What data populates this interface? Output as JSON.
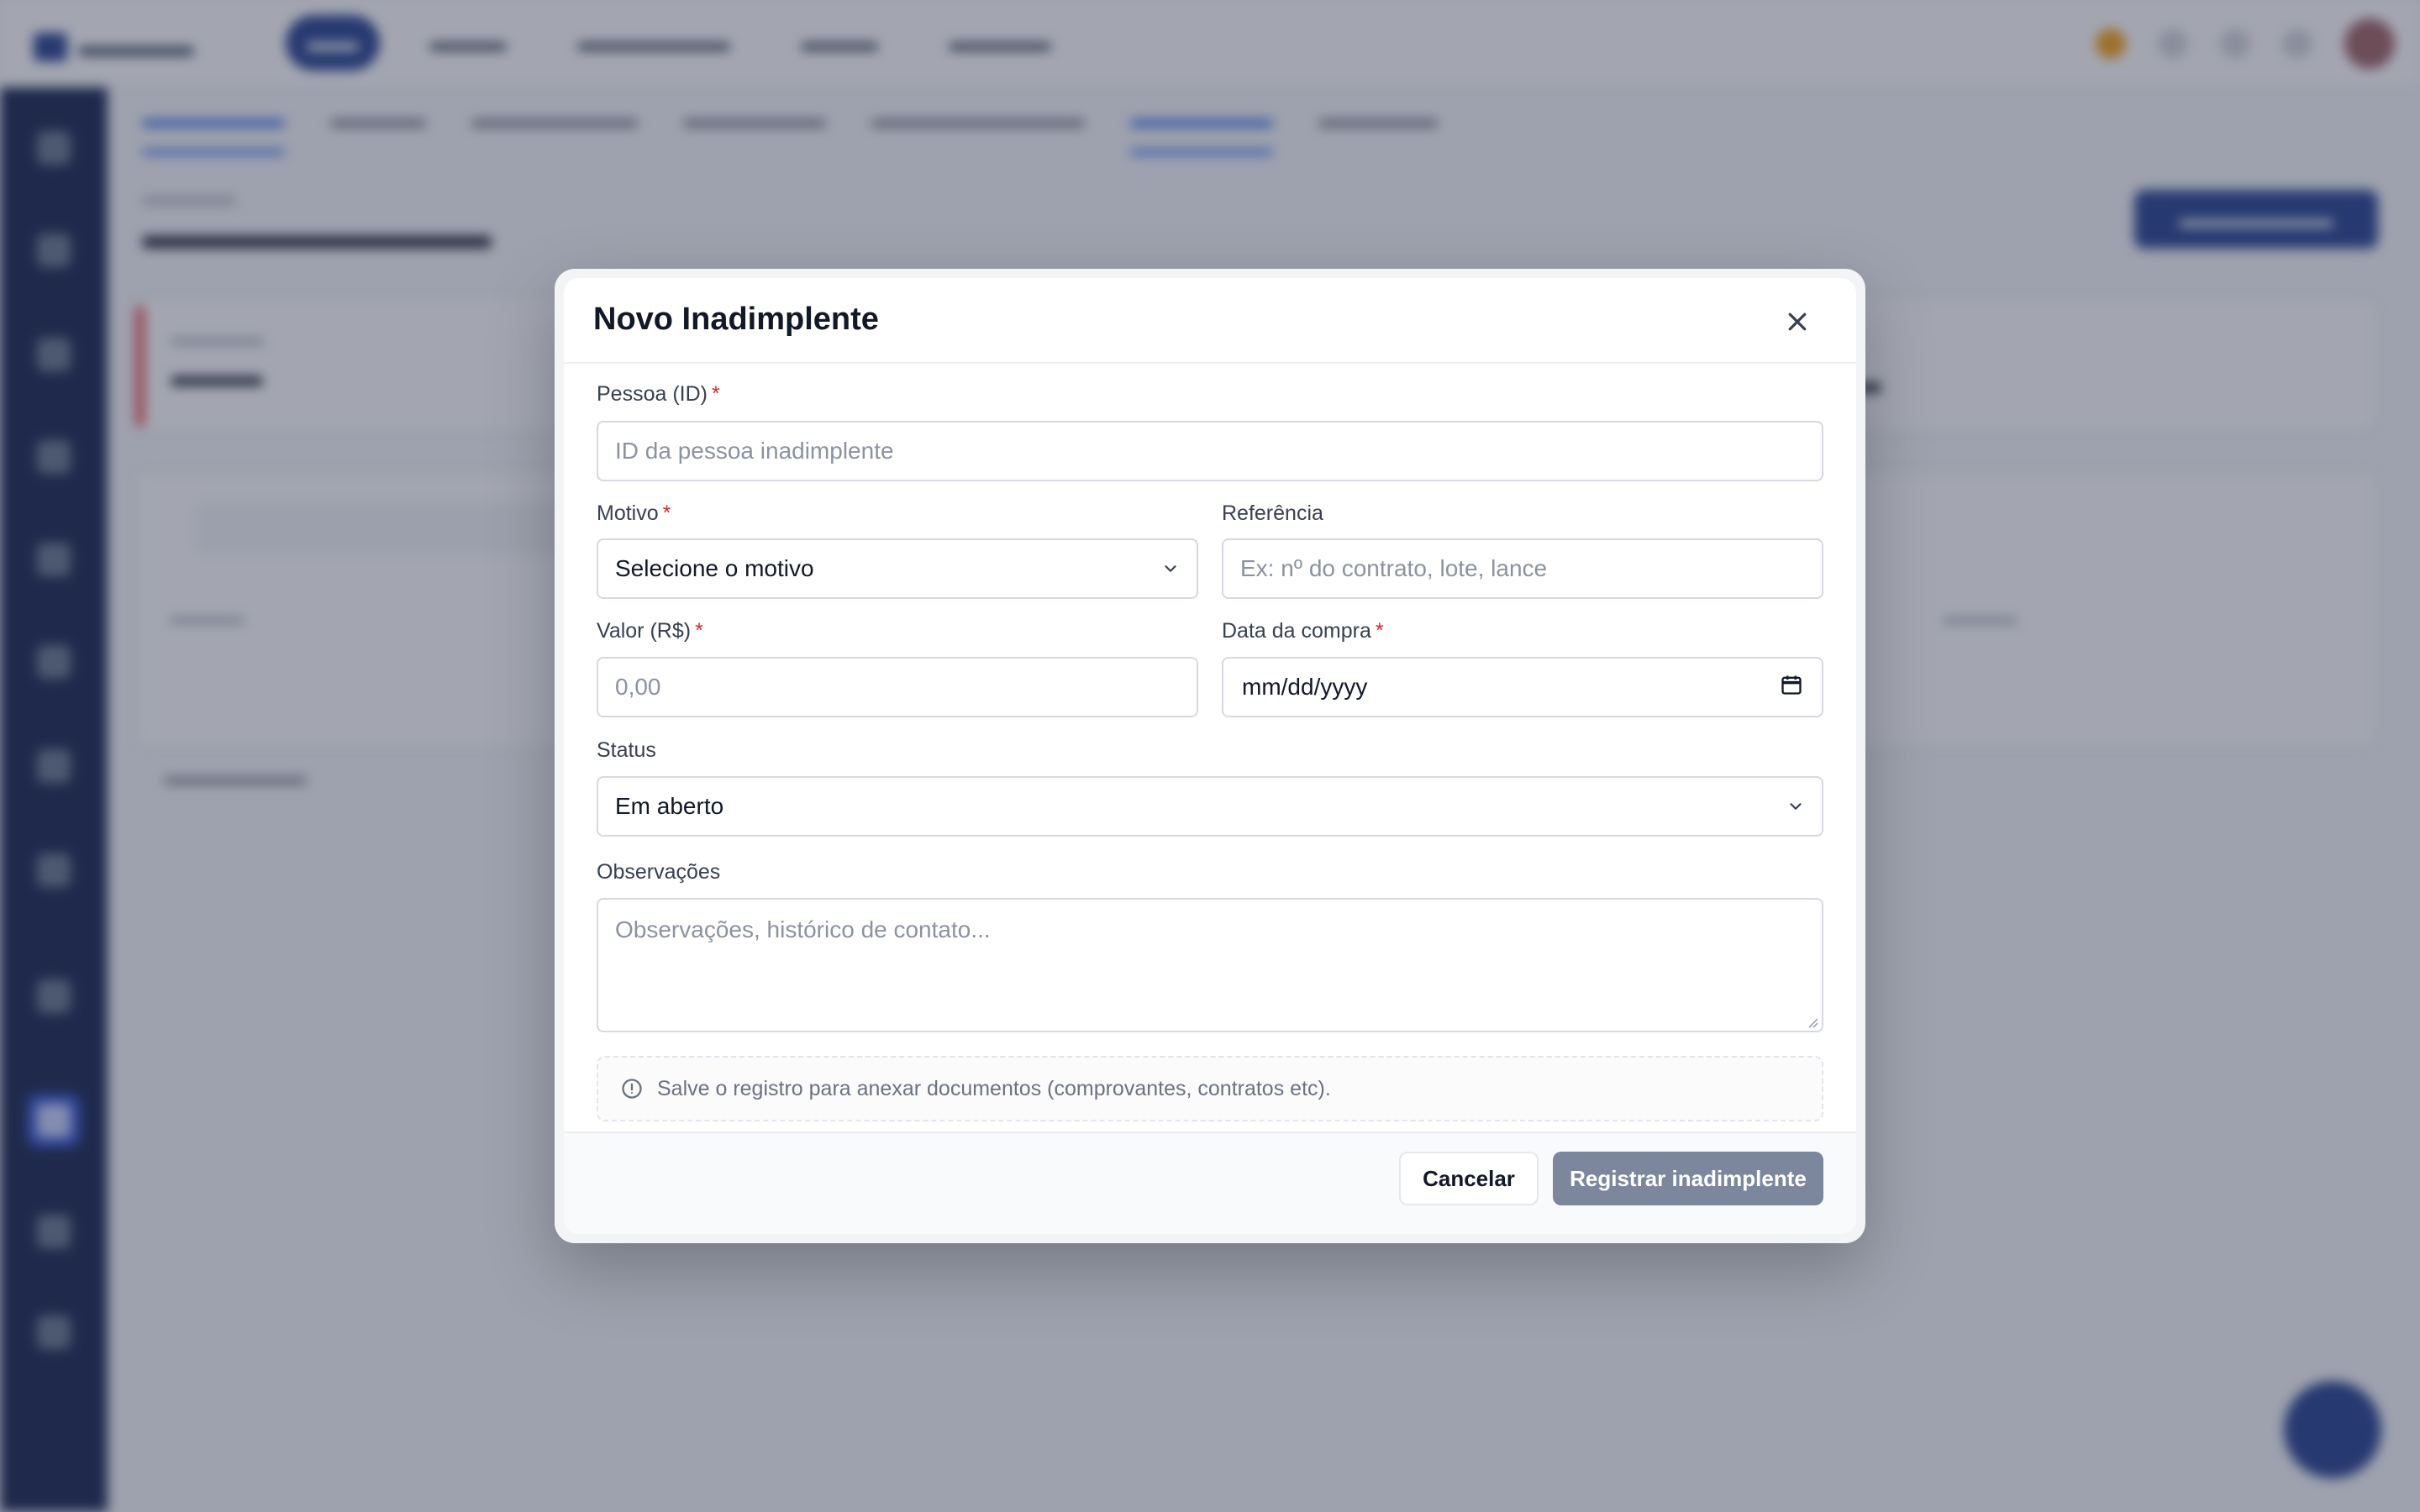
{
  "modal": {
    "title": "Novo Inadimplente",
    "fields": {
      "pessoa": {
        "label": "Pessoa (ID)",
        "required_mark": "*",
        "placeholder": "ID da pessoa inadimplente",
        "value": ""
      },
      "motivo": {
        "label": "Motivo",
        "required_mark": "*",
        "selected": "Selecione o motivo"
      },
      "referencia": {
        "label": "Referência",
        "placeholder": "Ex: nº do contrato, lote, lance",
        "value": ""
      },
      "valor": {
        "label": "Valor (R$)",
        "required_mark": "*",
        "placeholder": "0,00",
        "value": ""
      },
      "data_compra": {
        "label": "Data da compra",
        "required_mark": "*",
        "display": "mm/dd/yyyy"
      },
      "status": {
        "label": "Status",
        "selected": "Em aberto"
      },
      "observacoes": {
        "label": "Observações",
        "placeholder": "Observações, histórico de contato...",
        "value": ""
      }
    },
    "info_note": "Salve o registro para anexar documentos (comprovantes, contratos etc).",
    "buttons": {
      "cancel": "Cancelar",
      "submit": "Registrar inadimplente"
    },
    "colors": {
      "submit_disabled": "#7c879d",
      "required": "#dc2626",
      "overlay": "#333a52"
    }
  },
  "icons": {
    "close": "close-icon",
    "chevron": "chevron-down-icon",
    "calendar": "calendar-icon",
    "info": "info-circle-icon"
  }
}
